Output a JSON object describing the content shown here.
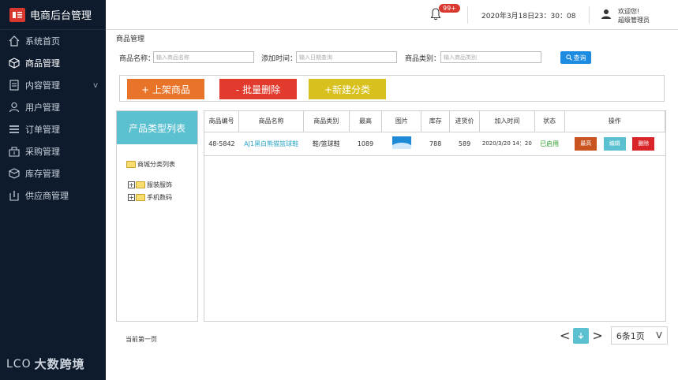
{
  "app": {
    "title": "电商后台管理"
  },
  "sidebar": {
    "items": [
      {
        "label": "系统首页",
        "icon": "home-icon"
      },
      {
        "label": "商品管理",
        "icon": "cube-icon",
        "active": true
      },
      {
        "label": "内容管理",
        "icon": "document-icon",
        "chevron": "v"
      },
      {
        "label": "用户管理",
        "icon": "user-icon"
      },
      {
        "label": "订单管理",
        "icon": "list-icon"
      },
      {
        "label": "采购管理",
        "icon": "cart-icon"
      },
      {
        "label": "库存管理",
        "icon": "box-icon"
      },
      {
        "label": "供应商管理",
        "icon": "supplier-icon"
      }
    ],
    "footer_logo": "大数跨境",
    "footer_mark": "LCO"
  },
  "topbar": {
    "notification_count": "99+",
    "datetime": "2020年3月18日23：30：08",
    "welcome": "欢迎您!",
    "role": "超级管理员"
  },
  "breadcrumb": "商品管理",
  "filters": {
    "name_label": "商品名称：",
    "name_placeholder": "输入商品名称",
    "time_label": "添加时间：",
    "time_placeholder": "输入日期查询",
    "category_label": "商品类别：",
    "category_placeholder": "输入商品类别",
    "search_button": "查询"
  },
  "actions": {
    "add_product": "+ 上架商品",
    "batch_delete": "- 批量删除",
    "new_category": "+新建分类"
  },
  "tree": {
    "title": "产品类型列表",
    "root": "商城分类列表",
    "nodes": [
      "服装服饰",
      "手机数码"
    ]
  },
  "table": {
    "headers": [
      "商品编号",
      "商品名称",
      "商品类别",
      "最高",
      "图片",
      "库存",
      "进货价",
      "加入时间",
      "状态",
      "操作"
    ],
    "rows": [
      {
        "id": "48-5842",
        "name": "AJ1黑白熊猫篮球鞋",
        "category": "鞋/篮球鞋",
        "max": "1089",
        "stock": "788",
        "purchase_price": "589",
        "added_time": "2020/3/20 14：20",
        "status": "已启用",
        "op_highest": "最高",
        "op_edit": "编辑",
        "op_delete": "删除"
      }
    ]
  },
  "pagination": {
    "current_text": "当前第一页",
    "prev": "<",
    "next": ">",
    "per_page": "6条1页",
    "dropdown": "V"
  },
  "colors": {
    "sidebar_bg": "#0e1b2d",
    "accent": "#5bc0d0",
    "orange": "#e8742a",
    "red": "#e23a2d",
    "yellow": "#d8c11e",
    "search_blue": "#1d8ce0"
  }
}
